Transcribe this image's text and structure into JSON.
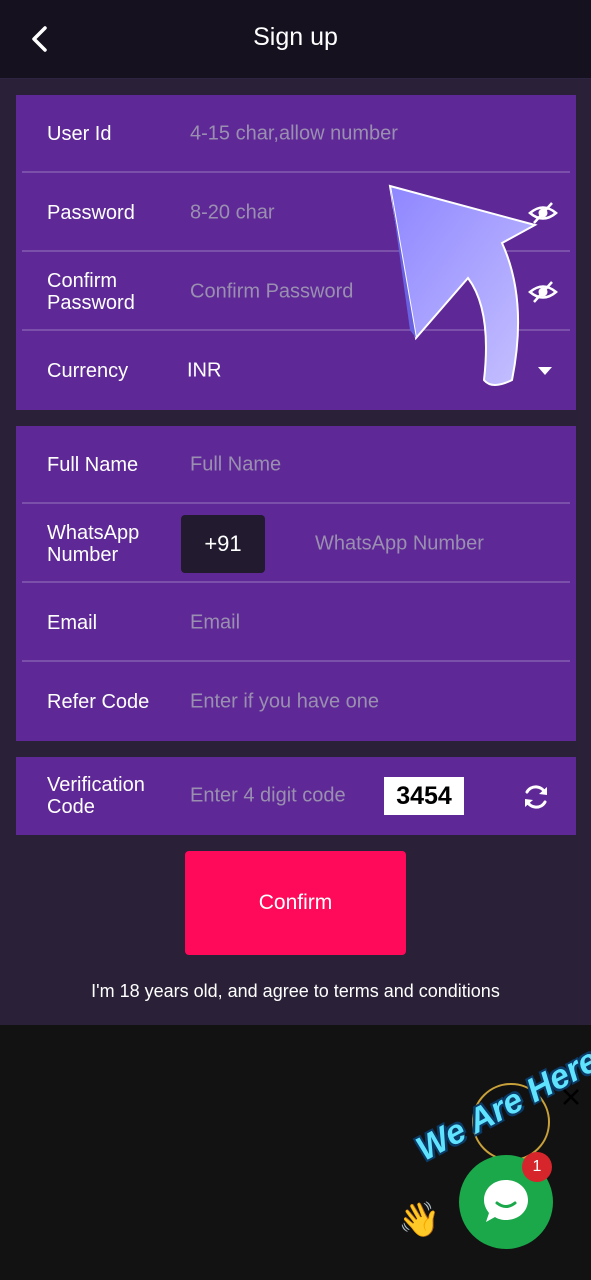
{
  "header": {
    "title": "Sign up",
    "back_icon": "chevron-left-icon"
  },
  "account_card": {
    "user_id": {
      "label": "User Id",
      "placeholder": "4-15 char,allow number"
    },
    "password": {
      "label": "Password",
      "placeholder": "8-20 char",
      "toggle_icon": "eye-off-icon"
    },
    "confirm_password": {
      "label_line1": "Confirm",
      "label_line2": "Password",
      "placeholder": "Confirm Password",
      "toggle_icon": "eye-off-icon"
    },
    "currency": {
      "label": "Currency",
      "value": "INR",
      "dropdown_icon": "caret-down-icon"
    }
  },
  "profile_card": {
    "full_name": {
      "label": "Full Name",
      "placeholder": "Full Name"
    },
    "whatsapp": {
      "label_line1": "WhatsApp",
      "label_line2": "Number",
      "country_code": "+91",
      "placeholder": "WhatsApp Number"
    },
    "email": {
      "label": "Email",
      "placeholder": "Email"
    },
    "refer_code": {
      "label": "Refer Code",
      "placeholder": "Enter if you have one"
    }
  },
  "verification_card": {
    "label_line1": "Verification",
    "label_line2": "Code",
    "placeholder": "Enter 4 digit code",
    "captcha": "3454",
    "refresh_icon": "refresh-icon"
  },
  "actions": {
    "confirm_label": "Confirm",
    "terms_text": "I'm 18 years old, and agree to terms and conditions"
  },
  "chat_widget": {
    "banner": "We Are Here!",
    "unread_count": "1",
    "icon": "chat-bubble-icon",
    "close_icon": "close-icon",
    "wave_icon": "waving-hand-icon"
  },
  "colors": {
    "card": "#5e2996",
    "background": "#2a2138",
    "confirm": "#ff0a5a",
    "chat": "#1aa84a"
  }
}
